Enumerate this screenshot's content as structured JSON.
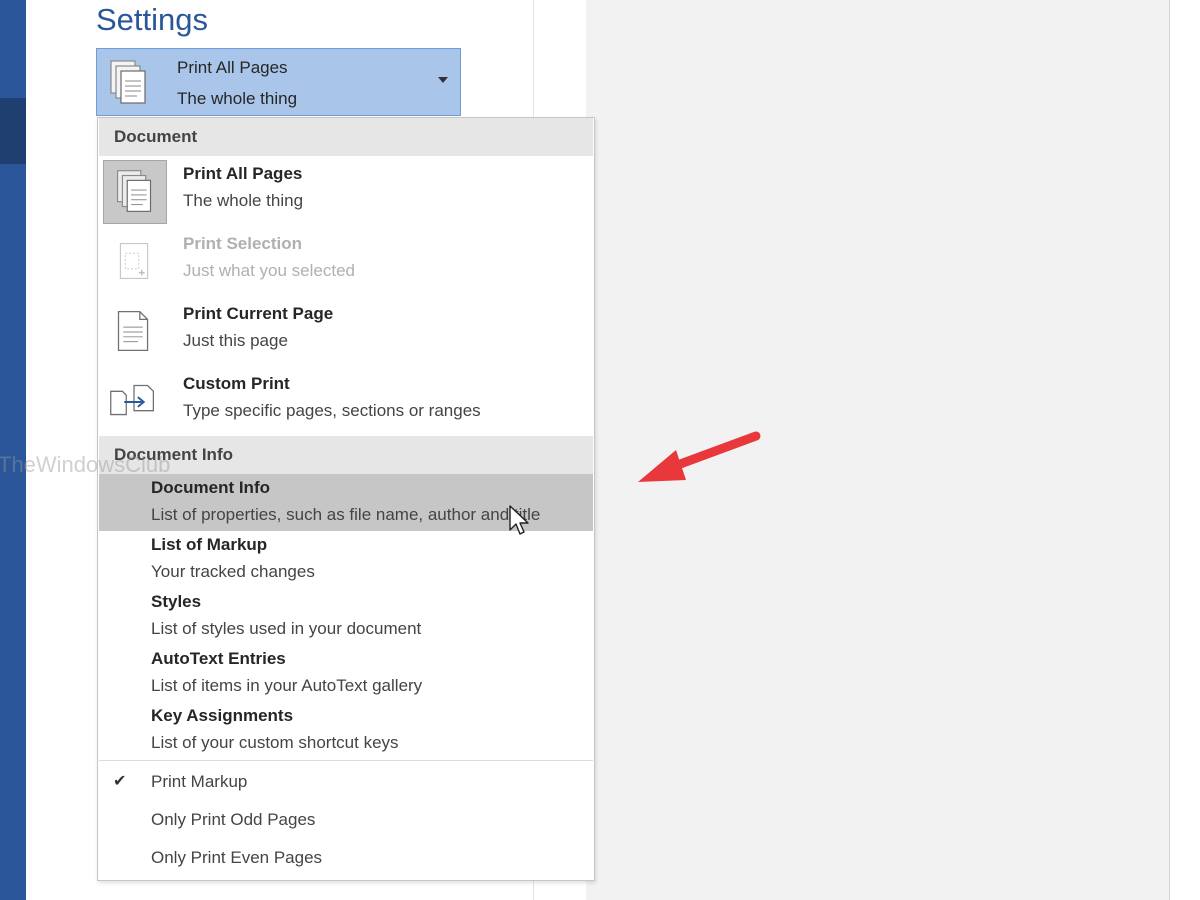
{
  "settings": {
    "title": "Settings",
    "dropdown": {
      "title": "Print All Pages",
      "subtitle": "The whole thing",
      "icon": "pages-stack-icon"
    }
  },
  "menu": {
    "groups": [
      {
        "header": "Document",
        "items": [
          {
            "title": "Print All Pages",
            "subtitle": "The whole thing",
            "icon": "pages-stack-icon",
            "state": "selected"
          },
          {
            "title": "Print Selection",
            "subtitle": "Just what you selected",
            "icon": "selection-page-icon",
            "state": "disabled"
          },
          {
            "title": "Print Current Page",
            "subtitle": "Just this page",
            "icon": "single-page-icon",
            "state": "normal"
          },
          {
            "title": "Custom Print",
            "subtitle": "Type specific pages, sections or ranges",
            "icon": "custom-pages-icon",
            "state": "normal"
          }
        ]
      },
      {
        "header": "Document Info",
        "items": [
          {
            "title": "Document Info",
            "subtitle": "List of properties, such as file name, author and title",
            "state": "hover"
          },
          {
            "title": "List of Markup",
            "subtitle": "Your tracked changes",
            "state": "normal"
          },
          {
            "title": "Styles",
            "subtitle": "List of styles used in your document",
            "state": "normal"
          },
          {
            "title": "AutoText Entries",
            "subtitle": "List of items in your AutoText gallery",
            "state": "normal"
          },
          {
            "title": "Key Assignments",
            "subtitle": "List of your custom shortcut keys",
            "state": "normal"
          }
        ]
      }
    ],
    "options": [
      {
        "label": "Print Markup",
        "checked": true
      },
      {
        "label": "Only Print Odd Pages",
        "checked": false
      },
      {
        "label": "Only Print Even Pages",
        "checked": false
      }
    ]
  },
  "watermark": "TheWindowsClub",
  "colors": {
    "accent": "#2b579a",
    "dropdown_fill": "#a9c5ea",
    "hover_row": "#c6c6c6",
    "annotation_arrow": "#e8383b"
  }
}
